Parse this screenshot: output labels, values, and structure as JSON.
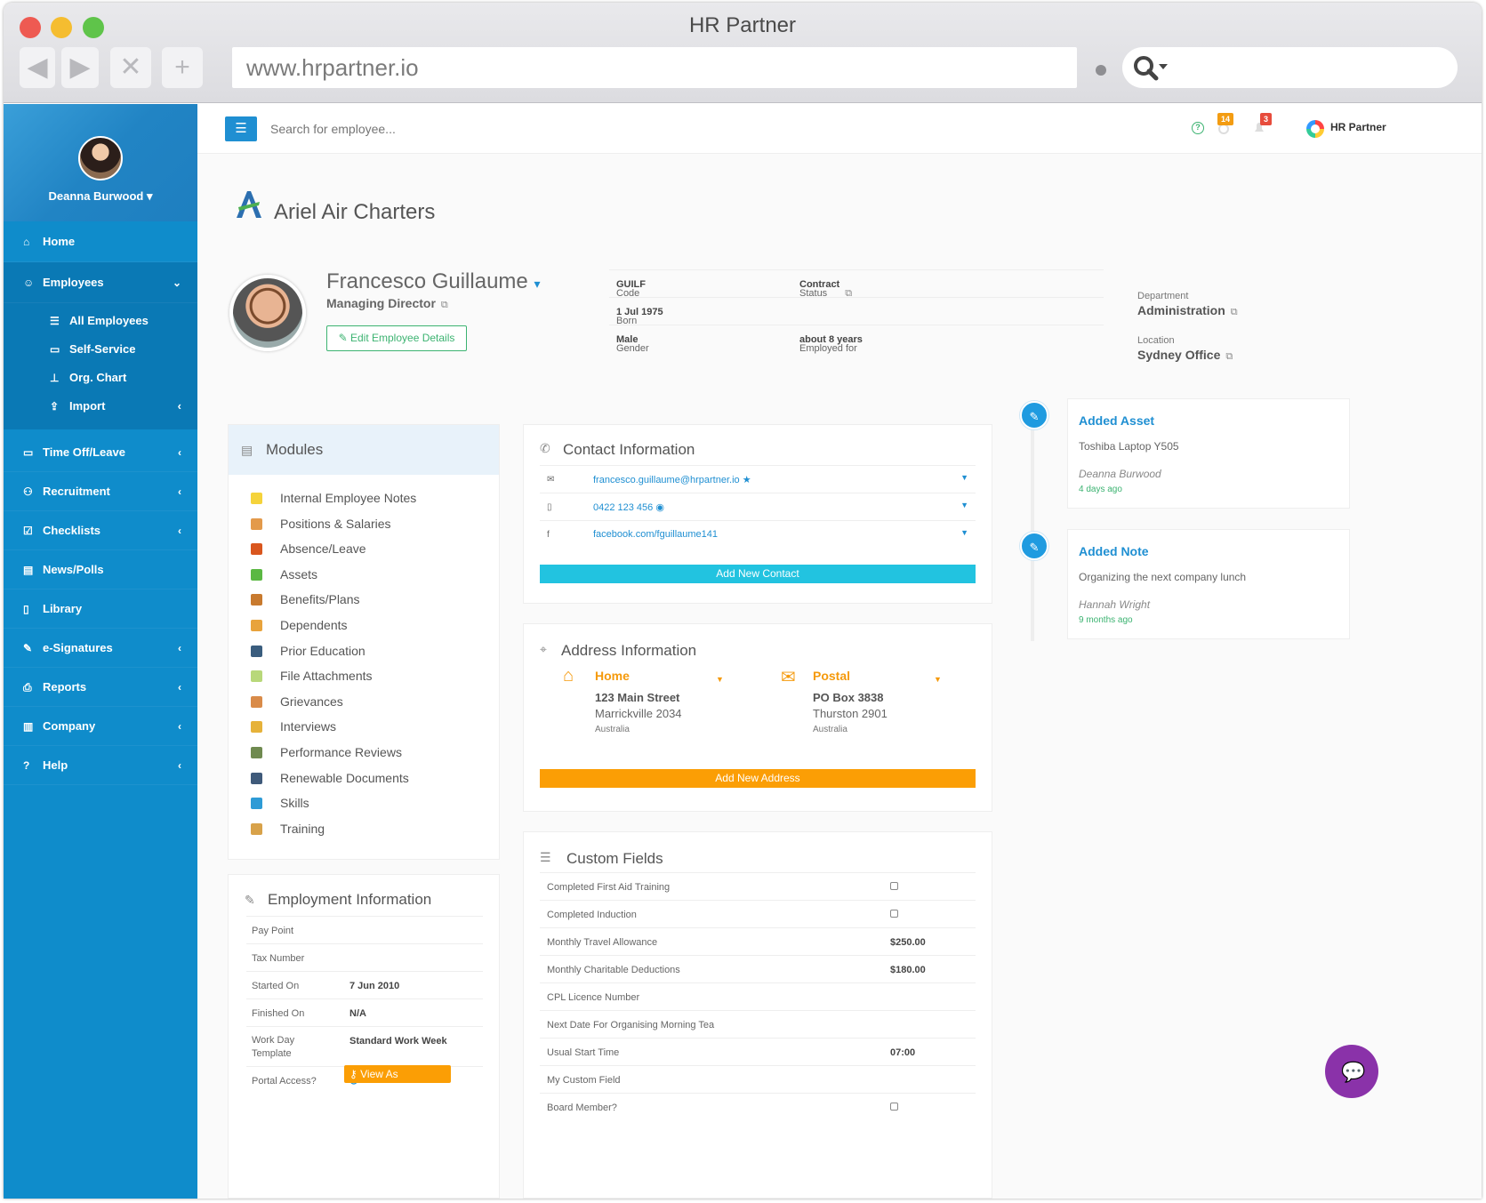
{
  "browser": {
    "window_title": "HR Partner",
    "url": "www.hrpartner.io",
    "nav": {
      "back": "◀",
      "forward": "▶",
      "close": "✕",
      "new": "+"
    }
  },
  "sidebar": {
    "user_name": "Deanna Burwood",
    "items": [
      {
        "label": "Home",
        "icon": "⌂"
      },
      {
        "label": "Employees",
        "icon": "☺"
      },
      {
        "label": "Time Off/Leave",
        "icon": "▭"
      },
      {
        "label": "Recruitment",
        "icon": "⚇"
      },
      {
        "label": "Checklists",
        "icon": "☑"
      },
      {
        "label": "News/Polls",
        "icon": "▤"
      },
      {
        "label": "Library",
        "icon": "▯"
      },
      {
        "label": "e-Signatures",
        "icon": "✎"
      },
      {
        "label": "Reports",
        "icon": "⎙"
      },
      {
        "label": "Company",
        "icon": "▥"
      },
      {
        "label": "Help",
        "icon": "?"
      }
    ],
    "employee_sub": [
      {
        "label": "All Employees",
        "icon": "☰"
      },
      {
        "label": "Self-Service",
        "icon": "▭"
      },
      {
        "label": "Org. Chart",
        "icon": "⊥"
      },
      {
        "label": "Import",
        "icon": "⇪"
      }
    ]
  },
  "topbar": {
    "menu_icon": "☰",
    "search_placeholder": "Search for employee...",
    "badge_tasks": "14",
    "badge_alerts": "3",
    "brand": "HR Partner"
  },
  "company": {
    "name": "Ariel Air Charters"
  },
  "employee": {
    "name": "Francesco Guillaume",
    "title": "Managing Director",
    "edit_label": "Edit Employee Details",
    "code_label": "Code",
    "code": "GUILF",
    "status_label": "Status",
    "status": "Contract",
    "born_label": "Born",
    "born": "1 Jul 1975",
    "gender_label": "Gender",
    "gender": "Male",
    "employed_label": "Employed for",
    "employed": "about 8 years",
    "department_label": "Department",
    "department": "Administration",
    "location_label": "Location",
    "location": "Sydney Office"
  },
  "modules": {
    "title": "Modules",
    "items": [
      {
        "label": "Internal Employee Notes",
        "color": "#f5d33b"
      },
      {
        "label": "Positions & Salaries",
        "color": "#e39a4b"
      },
      {
        "label": "Absence/Leave",
        "color": "#d9561e"
      },
      {
        "label": "Assets",
        "color": "#5bb843"
      },
      {
        "label": "Benefits/Plans",
        "color": "#c87a2e"
      },
      {
        "label": "Dependents",
        "color": "#e8a33c"
      },
      {
        "label": "Prior Education",
        "color": "#3a5d7e"
      },
      {
        "label": "File Attachments",
        "color": "#b8d87a"
      },
      {
        "label": "Grievances",
        "color": "#d98b49"
      },
      {
        "label": "Interviews",
        "color": "#e6b23a"
      },
      {
        "label": "Performance Reviews",
        "color": "#6f8a50"
      },
      {
        "label": "Renewable Documents",
        "color": "#3f5a7a"
      },
      {
        "label": "Skills",
        "color": "#2e9bd6"
      },
      {
        "label": "Training",
        "color": "#d8a24a"
      }
    ]
  },
  "employment": {
    "title": "Employment Information",
    "rows": [
      {
        "k": "Pay Point",
        "v": ""
      },
      {
        "k": "Tax Number",
        "v": ""
      },
      {
        "k": "Started On",
        "v": "7 Jun 2010"
      },
      {
        "k": "Finished On",
        "v": "N/A"
      },
      {
        "k": "Work Day Template",
        "v": "Standard Work Week"
      },
      {
        "k": "Portal Access?",
        "v": ""
      }
    ],
    "view_as_label": "View As Employee"
  },
  "contact": {
    "title": "Contact Information",
    "rows": [
      {
        "icon": "✉",
        "value": "francesco.guillaume@hrpartner.io ★"
      },
      {
        "icon": "▯",
        "value": "0422 123 456 ◉"
      },
      {
        "icon": "f",
        "value": "facebook.com/fguillaume141"
      }
    ],
    "add_label": "Add New Contact"
  },
  "address": {
    "title": "Address Information",
    "home": {
      "title": "Home",
      "line1": "123 Main Street",
      "line2": "Marrickville 2034",
      "country": "Australia"
    },
    "postal": {
      "title": "Postal",
      "line1": "PO Box 3838",
      "line2": "Thurston 2901",
      "country": "Australia"
    },
    "add_label": "Add New Address"
  },
  "custom": {
    "title": "Custom Fields",
    "rows": [
      {
        "k": "Completed First Aid Training",
        "v": "",
        "checkbox": true
      },
      {
        "k": "Completed Induction",
        "v": "",
        "checkbox": true
      },
      {
        "k": "Monthly Travel Allowance",
        "v": "$250.00",
        "checkbox": false
      },
      {
        "k": "Monthly Charitable Deductions",
        "v": "$180.00",
        "checkbox": false
      },
      {
        "k": "CPL Licence Number",
        "v": "",
        "checkbox": false
      },
      {
        "k": "Next Date For Organising Morning Tea",
        "v": "",
        "checkbox": false
      },
      {
        "k": "Usual Start Time",
        "v": "07:00",
        "checkbox": false
      },
      {
        "k": "My Custom Field",
        "v": "",
        "checkbox": false
      },
      {
        "k": "Board Member?",
        "v": "",
        "checkbox": true
      }
    ]
  },
  "timeline": [
    {
      "title": "Added Asset",
      "body": "Toshiba Laptop Y505",
      "by": "Deanna Burwood",
      "when": "4 days ago"
    },
    {
      "title": "Added Note",
      "body": "Organizing the next company lunch",
      "by": "Hannah Wright",
      "when": "9 months ago"
    }
  ]
}
